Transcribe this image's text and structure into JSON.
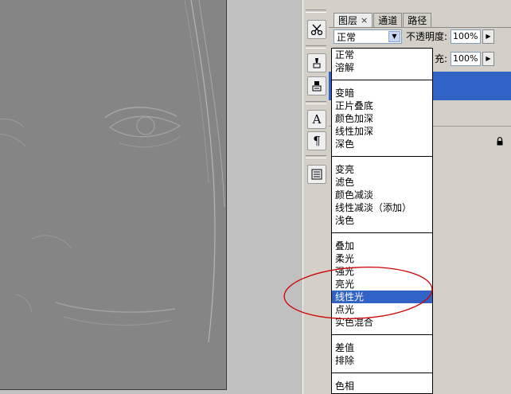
{
  "panel": {
    "tabs": [
      {
        "label": "图层",
        "close": "×"
      },
      {
        "label": "通道"
      },
      {
        "label": "路径"
      }
    ],
    "blend_mode": "正常",
    "opacity_label": "不透明度:",
    "opacity_value": "100%",
    "fill_label": "充:",
    "fill_value": "100%"
  },
  "blend_menu": {
    "groups": [
      [
        "正常",
        "溶解"
      ],
      [
        "变暗",
        "正片叠底",
        "颜色加深",
        "线性加深",
        "深色"
      ],
      [
        "变亮",
        "滤色",
        "颜色减淡",
        "线性减淡（添加）",
        "浅色"
      ],
      [
        "叠加",
        "柔光",
        "强光",
        "亮光",
        "线性光",
        "点光",
        "实色混合"
      ],
      [
        "差值",
        "排除"
      ],
      [
        "色相"
      ]
    ],
    "highlighted": "线性光"
  },
  "tools": [
    {
      "icon": "scissors-icon"
    },
    {
      "icon": "brush-preset-icon"
    },
    {
      "icon": "clone-source-icon"
    },
    {
      "icon": "character-icon"
    },
    {
      "icon": "paragraph-icon"
    },
    {
      "icon": "layer-comps-icon"
    }
  ],
  "colors": {
    "highlight": "#3163c6",
    "annotation_circle": "#cc0000",
    "canvas_gray": "#858585"
  }
}
